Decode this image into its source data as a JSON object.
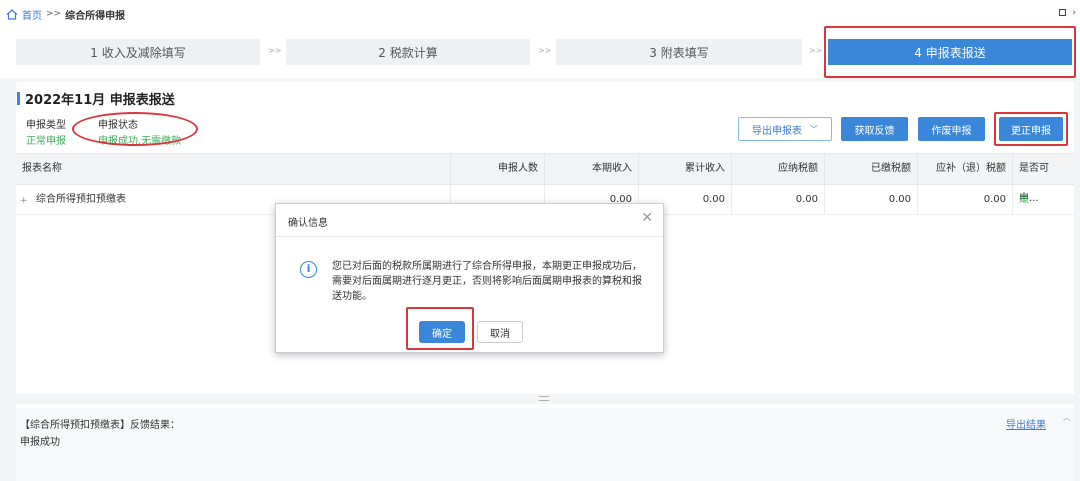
{
  "breadcrumb": {
    "home": "首页",
    "separator": ">>",
    "current": "综合所得申报"
  },
  "steps": [
    {
      "label": "1 收入及减除填写"
    },
    {
      "label": "2 税款计算"
    },
    {
      "label": "3 附表填写"
    },
    {
      "label": "4 申报表报送"
    }
  ],
  "step_separator": ">>",
  "page": {
    "title": "2022年11月  申报表报送",
    "filing_type_label": "申报类型",
    "filing_type_value": "正常申报",
    "filing_status_label": "申报状态",
    "filing_status_value": "申报成功,无需缴款"
  },
  "actions": {
    "export": "导出申报表",
    "feedback": "获取反馈",
    "void": "作废申报",
    "correct": "更正申报"
  },
  "table": {
    "headers": [
      "报表名称",
      "申报人数",
      "本期收入",
      "累计收入",
      "应纳税额",
      "已缴税额",
      "应补（退）税额",
      "是否可申..."
    ],
    "rows": [
      {
        "name": "综合所得预扣预缴表",
        "count": "",
        "period_income": "0.00",
        "cumulative_income": "0.00",
        "tax_payable": "0.00",
        "tax_paid": "0.00",
        "tax_due": "0.00",
        "can_file": "是"
      }
    ]
  },
  "feedback": {
    "title": "【综合所得预扣预缴表】反馈结果：",
    "result": "申报成功",
    "export_link": "导出结果"
  },
  "dialog": {
    "title": "确认信息",
    "message": "您已对后面的税款所属期进行了综合所得申报，本期更正申报成功后，需要对后面属期进行逐月更正，否则将影响后面属期申报表的算税和报送功能。",
    "ok": "确定",
    "cancel": "取消"
  },
  "colors": {
    "accent": "#3a86d8",
    "success": "#3bb05c",
    "highlight": "#d9363e"
  }
}
